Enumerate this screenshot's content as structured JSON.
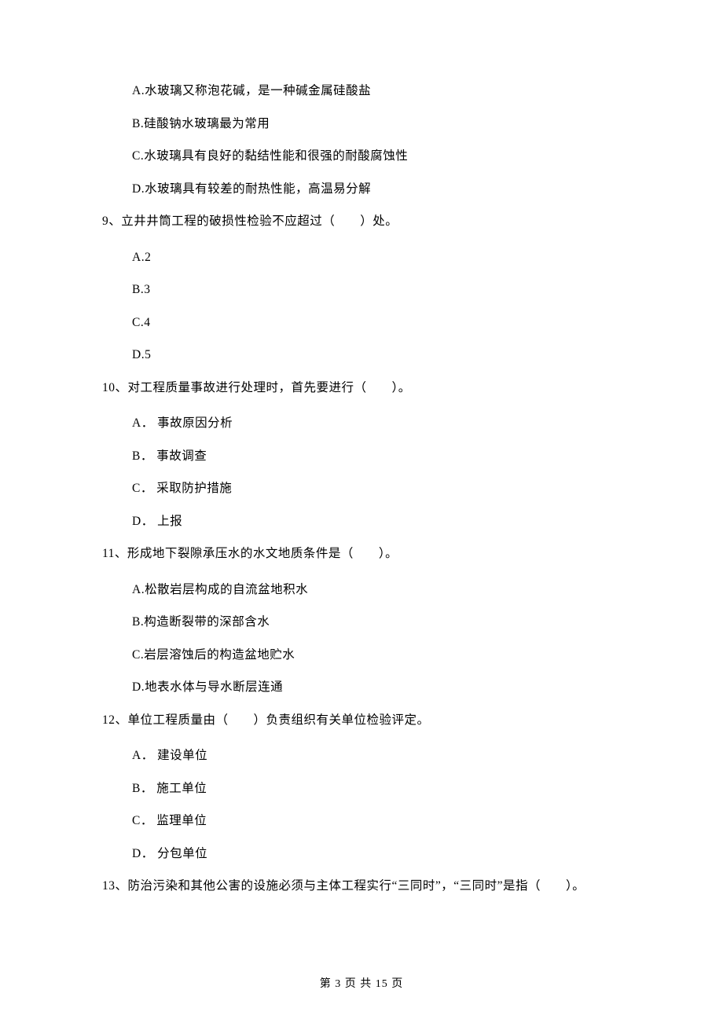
{
  "q8": {
    "optA": "A.水玻璃又称泡花碱，是一种碱金属硅酸盐",
    "optB": "B.硅酸钠水玻璃最为常用",
    "optC": "C.水玻璃具有良好的黏结性能和很强的耐酸腐蚀性",
    "optD": "D.水玻璃具有较差的耐热性能，高温易分解"
  },
  "q9": {
    "stem": "9、立井井筒工程的破损性检验不应超过（　　）处。",
    "optA": "A.2",
    "optB": "B.3",
    "optC": "C.4",
    "optD": "D.5"
  },
  "q10": {
    "stem": "10、对工程质量事故进行处理时，首先要进行（　　）。",
    "optA": "A． 事故原因分析",
    "optB": "B． 事故调查",
    "optC": "C． 采取防护措施",
    "optD": "D． 上报"
  },
  "q11": {
    "stem": "11、形成地下裂隙承压水的水文地质条件是（　　）。",
    "optA": "A.松散岩层构成的自流盆地积水",
    "optB": "B.构造断裂带的深部含水",
    "optC": "C.岩层溶蚀后的构造盆地贮水",
    "optD": "D.地表水体与导水断层连通"
  },
  "q12": {
    "stem": "12、单位工程质量由（　　）负责组织有关单位检验评定。",
    "optA": "A． 建设单位",
    "optB": "B． 施工单位",
    "optC": "C． 监理单位",
    "optD": "D． 分包单位"
  },
  "q13": {
    "stem": "13、防治污染和其他公害的设施必须与主体工程实行“三同时”，“三同时”是指（　　）。"
  },
  "footer": "第 3 页 共 15 页"
}
